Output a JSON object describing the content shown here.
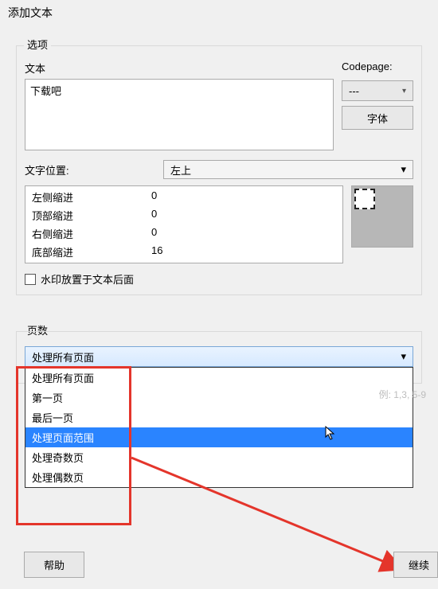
{
  "window": {
    "title": "添加文本"
  },
  "options": {
    "group_label": "选项",
    "text_label": "文本",
    "text_value": "下载吧",
    "codepage_label": "Codepage:",
    "codepage_value": "---",
    "font_button": "字体",
    "position_label": "文字位置:",
    "position_value": "左上",
    "indent": {
      "left_label": "左侧缩进",
      "left_value": "0",
      "top_label": "顶部缩进",
      "top_value": "0",
      "right_label": "右侧缩进",
      "right_value": "0",
      "bottom_label": "底部缩进",
      "bottom_value": "16"
    },
    "watermark_behind_label": "水印放置于文本后面"
  },
  "pages": {
    "group_label": "页数",
    "selected": "处理所有页面",
    "items": [
      "处理所有页面",
      "第一页",
      "最后一页",
      "处理页面范围",
      "处理奇数页",
      "处理偶数页"
    ],
    "highlight_index": 3,
    "example_hint": "例: 1,3, 5-9"
  },
  "footer": {
    "help": "帮助",
    "continue": "继续"
  }
}
